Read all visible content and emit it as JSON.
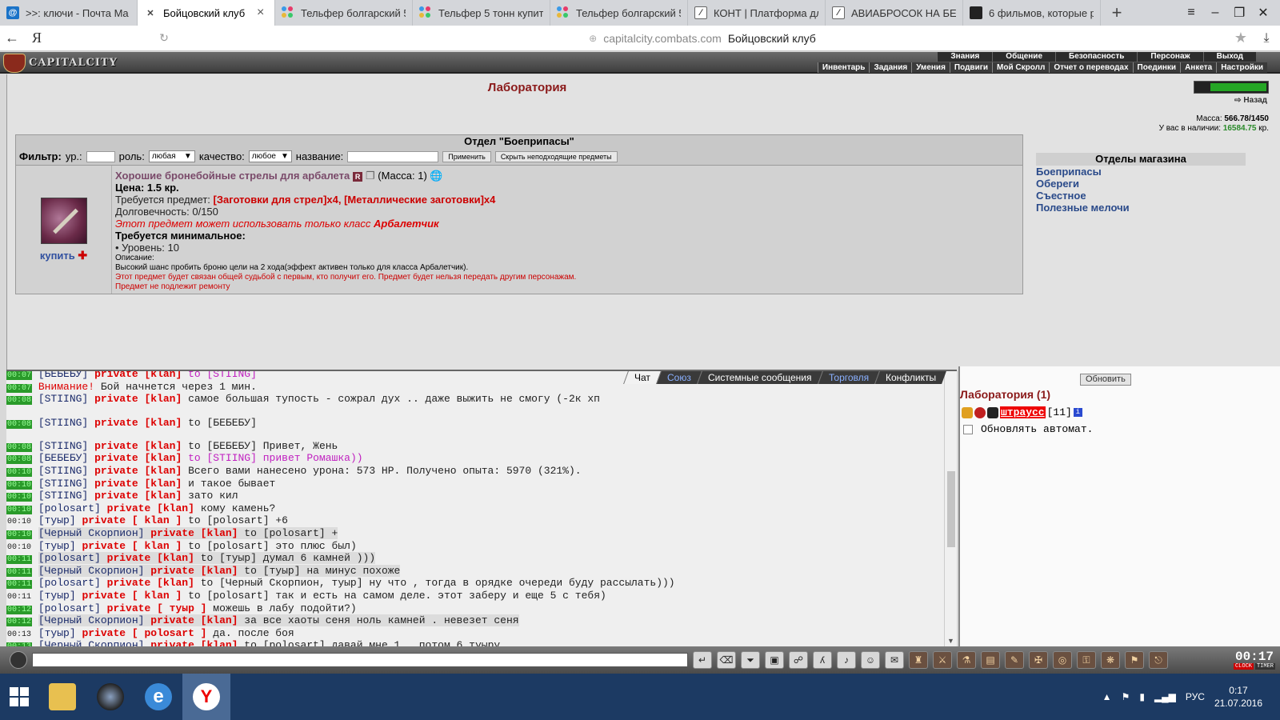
{
  "browser": {
    "tabs": [
      {
        "title": ">>: ключи - Почта Ma",
        "icon": "mail-icon",
        "active": false
      },
      {
        "title": "Бойцовский клуб",
        "icon": "fightclub-icon",
        "active": true
      },
      {
        "title": "Тельфер болгарский 5",
        "icon": "colored-dots-icon",
        "active": false
      },
      {
        "title": "Тельфер 5 тонн купить",
        "icon": "colored-dots-icon",
        "active": false
      },
      {
        "title": "Тельфер болгарский 5т",
        "icon": "colored-dots-icon",
        "active": false
      },
      {
        "title": "КОНТ | Платформа для",
        "icon": "document-icon",
        "active": false
      },
      {
        "title": "АВИАБРОСОК НА БЕРЛ",
        "icon": "document-icon",
        "active": false
      },
      {
        "title": "6 фильмов, которые ра",
        "icon": "film-icon",
        "active": false
      }
    ],
    "logo": "Я",
    "url_host": "capitalcity.combats.com",
    "url_title": "Бойцовский клуб"
  },
  "game": {
    "logo_text": "CAPITALCITY",
    "menu_top": [
      "Знания",
      "Общение",
      "Безопасность",
      "Персонаж",
      "Выход"
    ],
    "menu_bottom": [
      "Инвентарь",
      "Задания",
      "Умения",
      "Подвиги",
      "Мой Скролл",
      "Отчет о переводах",
      "Поединки",
      "Анкета",
      "Настройки"
    ]
  },
  "shop": {
    "title": "Лаборатория",
    "back": "Назад",
    "mass_label": "Масса:",
    "mass_value": "566.78/1450",
    "money_label": "У вас в наличии:",
    "money_value": "16584.75",
    "money_unit": "кр.",
    "hp_fraction": 0.95,
    "department_title": "Отдел \"Боеприпасы\"",
    "filter": {
      "label": "Фильтр:",
      "level_label": "ур.:",
      "role_label": "роль:",
      "role_value": "любая",
      "quality_label": "качество:",
      "quality_value": "любое",
      "name_label": "название:",
      "apply": "Применить",
      "hide": "Скрыть неподходящие предметы"
    },
    "item": {
      "name": "Хорошие бронебойные стрелы для арбалета",
      "badge": "R",
      "mass": "(Масса: 1)",
      "price": "Цена: 1.5 кр.",
      "requires_label": "Требуется предмет:",
      "requires_value": "[Заготовки для стрел]x4, [Металлические заготовки]x4",
      "durability": "Долговечность: 0/150",
      "class_note": "Этот предмет может использовать только класс",
      "class_name": "Арбалетчик",
      "min_req": "Требуется минимальное:",
      "level_req": "• Уровень: 10",
      "desc_label": "Описание:",
      "desc": "Высокий шанс пробить броню цели на 2 хода(эффект активен только для класса Арбалетчик).",
      "bound": "Этот предмет будет связан общей судьбой с первым, кто получит его. Предмет будет нельзя передать другим персонажам.",
      "no_repair": "Предмет не подлежит ремонту",
      "buy": "купить"
    },
    "departments": {
      "title": "Отделы магазина",
      "items": [
        "Боеприпасы",
        "Обереги",
        "Съестное",
        "Полезные мелочи"
      ]
    }
  },
  "chat": {
    "tabs": [
      "Чат",
      "Союз",
      "Системные сообщения",
      "Торговля",
      "Конфликты"
    ],
    "lines": [
      {
        "t": "00:07",
        "nick": "[БЕБЕБУ]",
        "priv": "private [klan]",
        "to": "to [STIING]",
        "msg": "",
        "pink": true
      },
      {
        "t": "00:07",
        "warn": "Внимание!",
        "msg": "Бой начнется через 1 мин."
      },
      {
        "t": "00:08",
        "nick": "[STIING]",
        "priv": "private [klan]",
        "to": "",
        "msg": "самое большая тупость - сожрал дух .. даже выжить не смогу (-2к хп"
      },
      {
        "t": "00:08",
        "nick": "[STIING]",
        "priv": "private [klan]",
        "to": "to [БЕБЕБУ]",
        "msg": ""
      },
      {
        "t": "00:08",
        "nick": "[STIING]",
        "priv": "private [klan]",
        "to": "to [БЕБЕБУ]",
        "msg": "Привет, Жень"
      },
      {
        "t": "00:08",
        "nick": "[БЕБЕБУ]",
        "priv": "private [klan]",
        "to": "to [STIING]",
        "msg": "привет Ромашка))",
        "pink": true
      },
      {
        "t": "00:10",
        "nick": "[STIING]",
        "priv": "private [klan]",
        "to": "",
        "msg": "Всего вами нанесено урона: 573 HP. Получено опыта: 5970 (321%)."
      },
      {
        "t": "00:10",
        "nick": "[STIING]",
        "priv": "private [klan]",
        "to": "",
        "msg": "и такое бывает"
      },
      {
        "t": "00:10",
        "nick": "[STIING]",
        "priv": "private [klan]",
        "to": "",
        "msg": "зато кил"
      },
      {
        "t": "00:10",
        "nick": "[polosart]",
        "priv": "private [klan]",
        "to": "",
        "msg": "кому камень?"
      },
      {
        "t": "00:10",
        "nick": "[туыр]",
        "priv": "private [ klan ]",
        "to": "to [polosart]",
        "msg": "+6",
        "plain": true
      },
      {
        "t": "00:10",
        "nick": "[Черный Скорпион]",
        "priv": "private [klan]",
        "to": "to [polosart]",
        "msg": "+",
        "hl": true
      },
      {
        "t": "00:10",
        "nick": "[туыр]",
        "priv": "private [ klan ]",
        "to": "to [polosart]",
        "msg": "это плюс был)",
        "plain": true
      },
      {
        "t": "00:11",
        "nick": "[polosart]",
        "priv": "private [klan]",
        "to": "to [туыр]",
        "msg": "думал 6 камней )))",
        "hl": true
      },
      {
        "t": "00:11",
        "nick": "[Черный Скорпион]",
        "priv": "private [klan]",
        "to": "to [туыр]",
        "msg": "на минус похоже",
        "hl": true
      },
      {
        "t": "00:11",
        "nick": "[polosart]",
        "priv": "private [klan]",
        "to": "to [Черный Скорпион, туыр]",
        "msg": "ну что , тогда в орядке очереди буду рассылать)))"
      },
      {
        "t": "00:11",
        "nick": "[туыр]",
        "priv": "private [ klan ]",
        "to": "to [polosart]",
        "msg": "так и есть на самом деле. этот заберу и еще 5 с тебя)",
        "plain": true
      },
      {
        "t": "00:12",
        "nick": "[polosart]",
        "priv": "private [ туыр ]",
        "to": "",
        "msg": "можешь в лабу подойти?)"
      },
      {
        "t": "00:12",
        "nick": "[Черный Скорпион]",
        "priv": "private [klan]",
        "to": "",
        "msg": "за все хаоты сеня ноль камней . невезет сеня",
        "hl": true
      },
      {
        "t": "00:13",
        "nick": "[туыр]",
        "priv": "private [ polosart ]",
        "to": "",
        "msg": "да. после боя",
        "plain": true
      },
      {
        "t": "00:13",
        "nick": "[Черный Скорпион]",
        "priv": "private [klan]",
        "to": "to [polosart]",
        "msg": "давай мне 1 , потом 6 туыру"
      }
    ]
  },
  "room": {
    "refresh": "Обновить",
    "title": "Лаборатория (1)",
    "user_name": "штраусс",
    "user_level": "[11]",
    "auto_refresh": "Обновлять автомат."
  },
  "clock": {
    "time": "00:17",
    "clock_label": "CLOCK",
    "timer_label": "TIMER"
  },
  "taskbar": {
    "lang": "РУС",
    "time": "0:17",
    "date": "21.07.2016"
  }
}
